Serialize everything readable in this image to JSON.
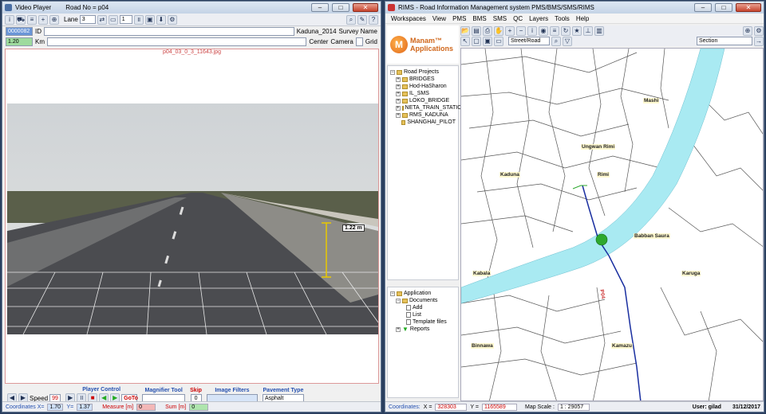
{
  "left_window": {
    "title": "Video Player",
    "road_title": "Road No = p04",
    "toolbar": {
      "lane_label": "Lane",
      "lane_value": "3",
      "counter_value": "1"
    },
    "id_value": "0000082",
    "id_label": "ID",
    "km_value": "1.20",
    "km_label": "Km",
    "kaduna_value": "Kaduna_2014",
    "survey_label": "Survey Name",
    "center_value": "Center",
    "camera_label": "Camera",
    "grid_label": "Grid",
    "frame_name": "p04_03_0_3_11643.jpg",
    "measure_label": "1.22 m",
    "controls": {
      "speed_label": "Speed",
      "speed_value": "99",
      "player_control": "Player Control",
      "goto_label": "GoTo",
      "magnifier_tool": "Magnifier Tool",
      "skip_label": "Skip",
      "skip_value": "0",
      "image_filters": "Image Filters",
      "pavement_type": "Pavement Type",
      "pavement_value": "Asphalt"
    },
    "status": {
      "coords_label": "Coordinates X=",
      "x_value": "1.70",
      "y_label": "Y=",
      "y_value": "1.37",
      "measure_label": "Measure [m]",
      "measure_value": "0",
      "sum_label": "Sum [m]",
      "sum_value": "0"
    }
  },
  "right_window": {
    "title": "RIMS - Road Information Management system PMS/BMS/SMS/RIMS",
    "menu": [
      "Workspaces",
      "View",
      "PMS",
      "BMS",
      "SMS",
      "QC",
      "Layers",
      "Tools",
      "Help"
    ],
    "street_road": "Street/Road",
    "section": "Section",
    "logo_line1": "Manam™",
    "logo_line2": "Applications",
    "projects_root": "Road Projects",
    "projects": [
      "BRIDGES",
      "Hod-HaSharon",
      "IL_SMS",
      "LOKO_BRIDGE",
      "NETA_TRAIN_STATIO",
      "RMS_KADUNA",
      "SHANGHAI_PILOT"
    ],
    "application_root": "Application",
    "app_tree": [
      "Documents",
      "Add",
      "List",
      "Template files",
      "Reports"
    ],
    "map_labels": {
      "mashi": "Mashi",
      "ungwan_rimi": "Ungwan Rimi",
      "kaduna": "Kaduna",
      "rimi": "Rimi",
      "babban_saura": "Babban Saura",
      "karuga": "Karuga",
      "kabala": "Kabala",
      "p04": "P04",
      "binnawa": "Binnawa",
      "kamazu": "Kamazu"
    },
    "status": {
      "coords_label": "Coordinates:",
      "x_label": "X =",
      "x_value": "328303",
      "y_label": "Y =",
      "y_value": "1165589",
      "scale_label": "Map Scale :",
      "scale_value": "1 : 29057",
      "user_label": "User: gilad",
      "date_value": "31/12/2017"
    }
  },
  "colors": {
    "river": "#a9eaf2",
    "road_line": "#1a2fa0",
    "accent": "#3a6fc8"
  }
}
